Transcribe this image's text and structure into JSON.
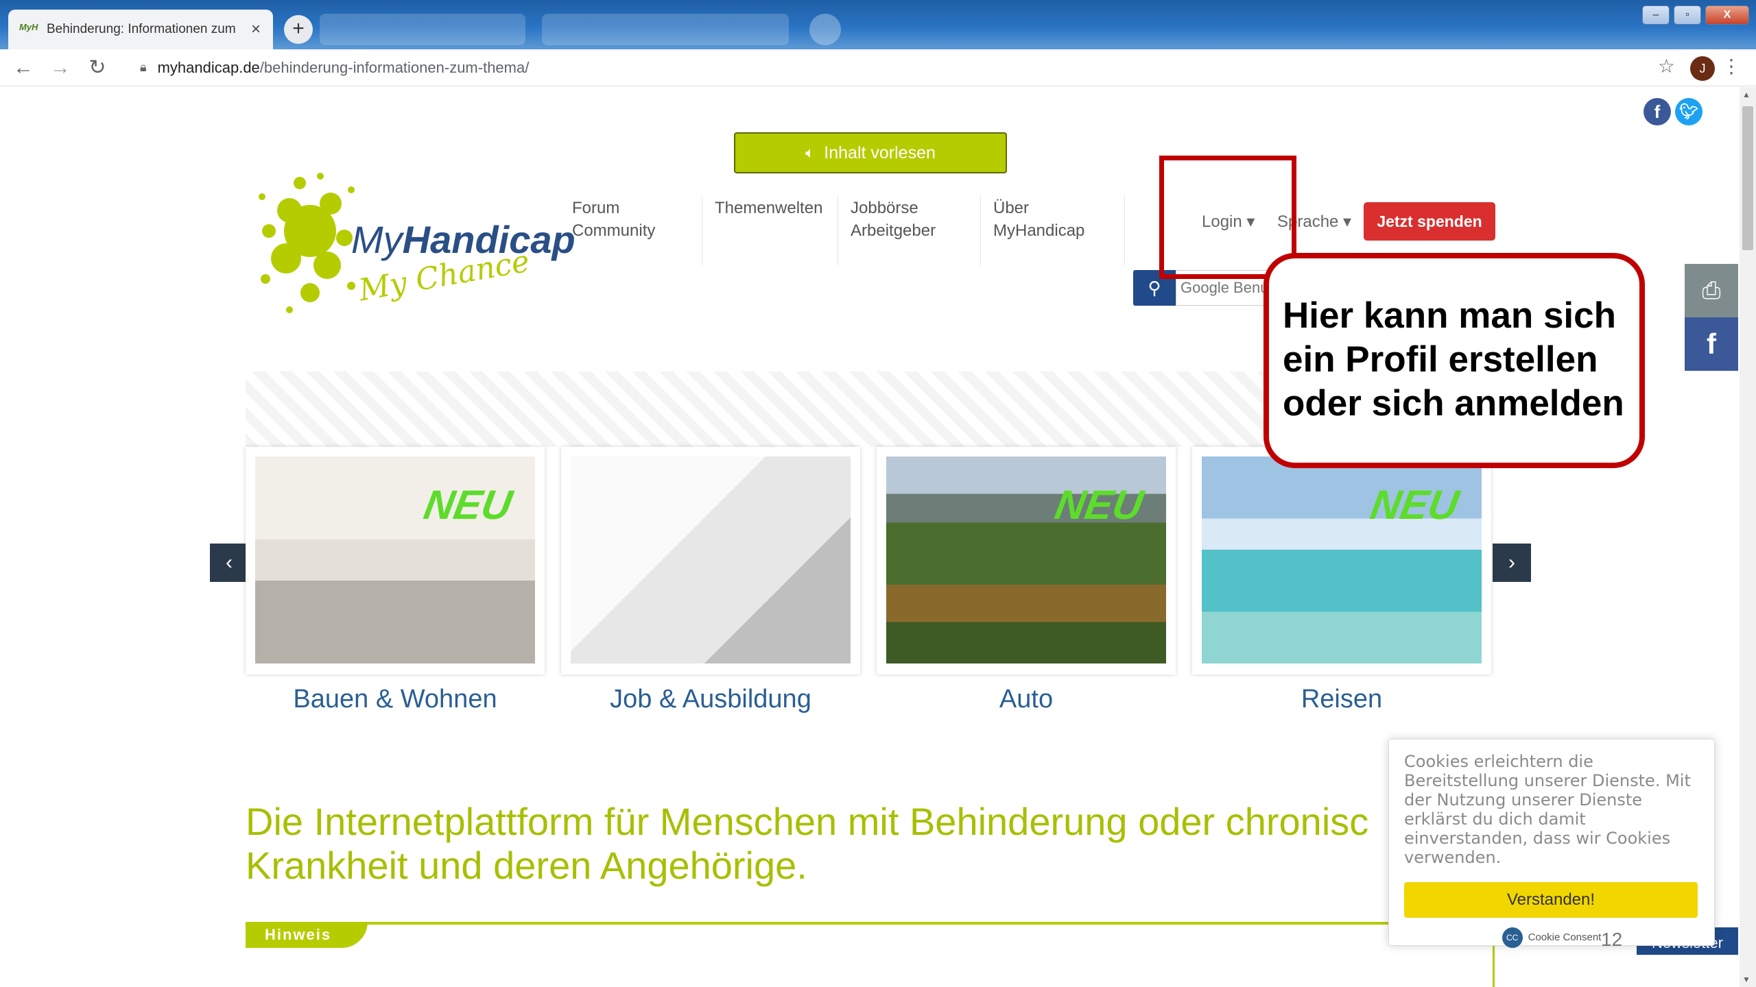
{
  "browser": {
    "tab_title": "Behinderung: Informationen zum",
    "tab_favicon_text": "MyH",
    "tab_close": "×",
    "new_tab": "+",
    "url_host": "myhandicap.de",
    "url_path": "/behinderung-informationen-zum-thema/",
    "profile_initial": "J",
    "window_controls": {
      "minimize": "–",
      "maximize": "▫",
      "close": "X"
    }
  },
  "page": {
    "read_aloud_label": "Inhalt vorlesen",
    "logo": {
      "title_prefix": "My",
      "title_bold": "Handicap",
      "subtitle": "My Chance"
    },
    "nav": [
      {
        "line1": "Forum",
        "line2": "Community"
      },
      {
        "line1": "Themenwelten",
        "line2": ""
      },
      {
        "line1": "Jobbörse",
        "line2": "Arbeitgeber"
      },
      {
        "line1": "Über",
        "line2": "MyHandicap"
      }
    ],
    "login_label": "Login",
    "language_label": "Sprache",
    "donate_label": "Jetzt spenden",
    "search_placeholder": "Google Benu",
    "callout_text": "Hier kann man sich ein Profil erstellen oder sich anmelden",
    "cards": [
      {
        "label": "Bauen & Wohnen",
        "badge": "NEU"
      },
      {
        "label": "Job & Ausbildung",
        "badge": ""
      },
      {
        "label": "Auto",
        "badge": "NEU"
      },
      {
        "label": "Reisen",
        "badge": "NEU"
      }
    ],
    "headline": "Die Internetplattform für Menschen mit Behinderung oder chronisc\nKrankheit und deren Angehörige.",
    "headline_line1": "Die Internetplattform für Menschen mit Behinderung oder chronisc",
    "headline_line2": "Krankheit und deren Angehörige.",
    "hinweis_label": "Hinweis",
    "newsletter_label": "Newsletter",
    "page_number": "12"
  },
  "cookie": {
    "text": "Cookies erleichtern die Bereitstellung unserer Dienste. Mit der Nutzung unserer Dienste erklärst du dich damit einverstanden, dass wir Cookies verwenden.",
    "button": "Verstanden!",
    "footer": "Cookie Consent"
  },
  "colors": {
    "brand_green": "#b5cc00",
    "brand_blue": "#204a8a",
    "donate_red": "#d92f2f",
    "annotation_red": "#c00000"
  }
}
